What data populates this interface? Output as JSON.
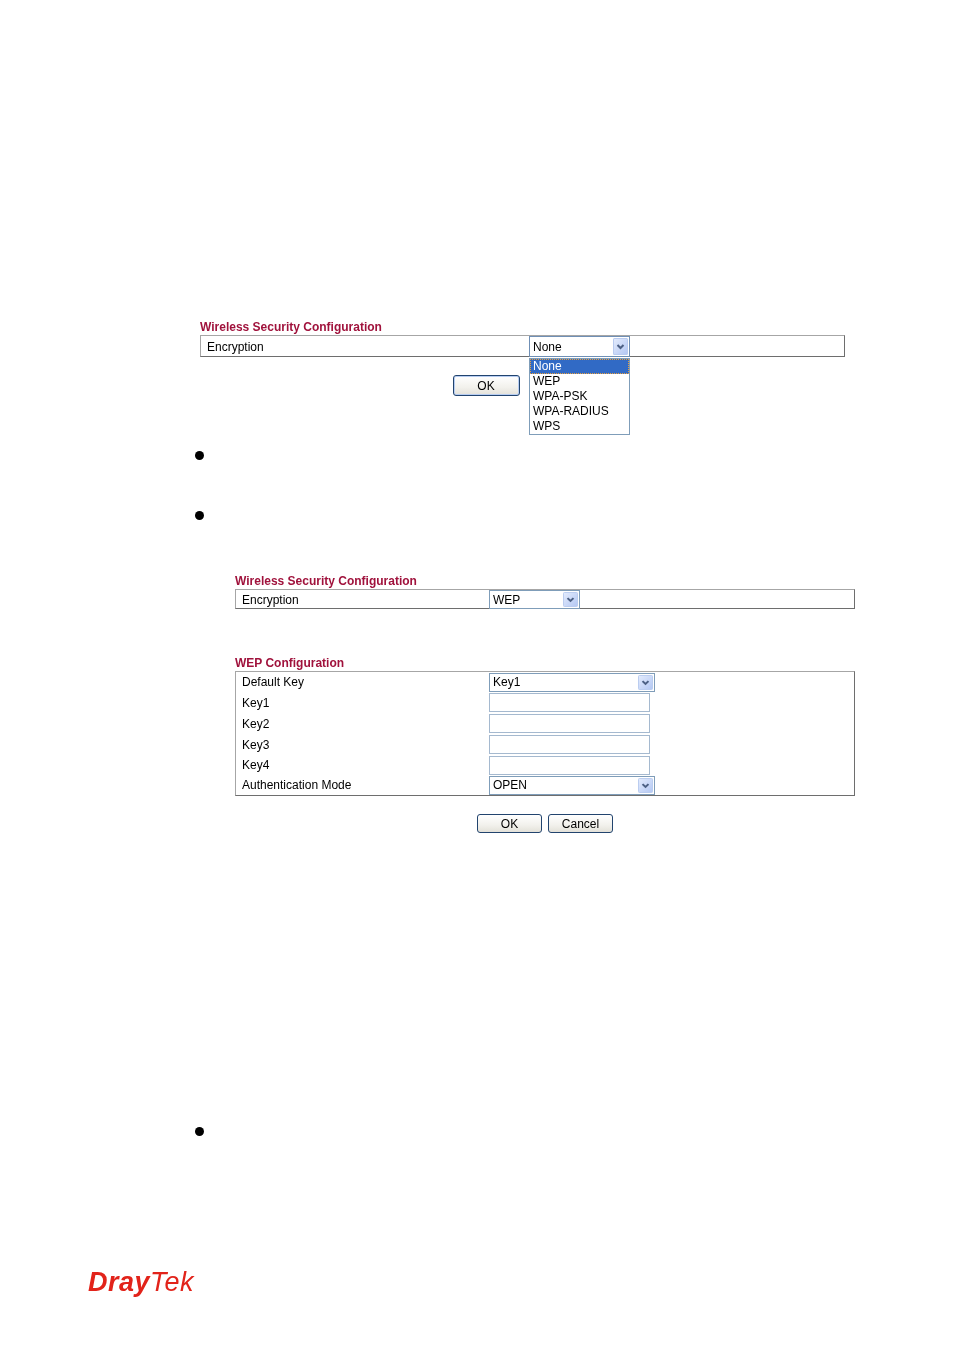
{
  "top_form": {
    "title": "Wireless Security Configuration",
    "rows": [
      {
        "label": "Encryption",
        "kind": "select",
        "value": "None",
        "expanded": true,
        "options": [
          {
            "label": "None",
            "selected": true
          },
          {
            "label": "WEP",
            "selected": false
          },
          {
            "label": "WPA-PSK",
            "selected": false
          },
          {
            "label": "WPA-RADIUS",
            "selected": false
          },
          {
            "label": "WPS",
            "selected": false
          }
        ]
      }
    ],
    "buttons": [
      {
        "label": "OK"
      }
    ]
  },
  "wep_form": {
    "tables": [
      {
        "title": "Wireless Security Configuration",
        "rows": [
          {
            "label": "Encryption",
            "kind": "select",
            "value": "WEP",
            "expanded": false
          }
        ]
      },
      {
        "title": "WEP Configuration",
        "rows": [
          {
            "label": "Default Key",
            "kind": "select",
            "value": "Key1",
            "expanded": false
          },
          {
            "label": "Key1",
            "kind": "input"
          },
          {
            "label": "Key2",
            "kind": "input"
          },
          {
            "label": "Key3",
            "kind": "input"
          },
          {
            "label": "Key4",
            "kind": "input"
          },
          {
            "label": "Authentication Mode",
            "kind": "select",
            "value": "OPEN",
            "expanded": false
          }
        ]
      }
    ],
    "buttons": [
      {
        "label": "OK"
      },
      {
        "label": "Cancel"
      }
    ]
  },
  "logo": "**Dray**Tek"
}
